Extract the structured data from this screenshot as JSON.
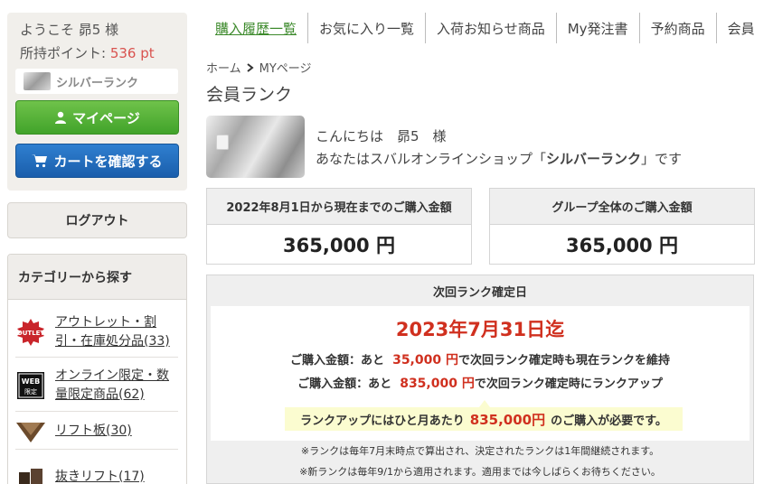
{
  "sidebar": {
    "welcome_prefix": "ようこそ",
    "user_name": "昴5",
    "welcome_suffix": "様",
    "points_label": "所持ポイント:",
    "points_value": "536 pt",
    "rank_label": "シルバーランク",
    "mypage_button": "マイページ",
    "cart_button": "カートを確認する",
    "logout": "ログアウト",
    "category_heading": "カテゴリーから探す",
    "categories": [
      {
        "label": "アウトレット・割引・在庫処分品(33)",
        "icon": "outlet-icon"
      },
      {
        "label": "オンライン限定・数量限定商品(62)",
        "icon": "web-limited-icon"
      },
      {
        "label": "リフト板(30)",
        "icon": "lift-board-icon"
      },
      {
        "label": "抜きリフト(17)",
        "icon": "lift-icon"
      }
    ]
  },
  "topnav": {
    "tabs": [
      "購入履歴一覧",
      "お気に入り一覧",
      "入荷お知らせ商品",
      "My発注書",
      "予約商品",
      "会員"
    ]
  },
  "breadcrumb": {
    "home": "ホーム",
    "current": "MYページ"
  },
  "page_title": "会員ランク",
  "greeting": {
    "line1": "こんにちは　昴5　様",
    "line2_prefix": "あなたはスバルオンラインショップ「",
    "rank_name": "シルバーランク",
    "line2_suffix": "」です"
  },
  "amounts": {
    "period_label": "2022年8月1日から現在までのご購入金額",
    "period_value": "365,000 円",
    "group_label": "グループ全体のご購入金額",
    "group_value": "365,000 円"
  },
  "next_rank": {
    "heading": "次回ランク確定日",
    "date": "2023年7月31日迄",
    "maintain_prefix": "ご購入金額：あと",
    "maintain_amount": "35,000 円",
    "maintain_suffix": "で次回ランク確定時も現在ランクを維持",
    "upgrade_prefix": "ご購入金額：あと",
    "upgrade_amount": "835,000 円",
    "upgrade_suffix": "で次回ランク確定時にランクアップ",
    "monthly_prefix": "ランクアップにはひと月あたり",
    "monthly_amount": "835,000円",
    "monthly_suffix": "のご購入が必要です。",
    "note1": "※ランクは毎年7月末時点で算出され、決定されたランクは1年間継続されます。",
    "note2": "※新ランクは毎年9/1から適用されます。適用までは今しばらくお待ちください。"
  },
  "colors": {
    "accent_green": "#41a32a",
    "accent_blue": "#1a5eac",
    "price_red": "#d0301f"
  }
}
